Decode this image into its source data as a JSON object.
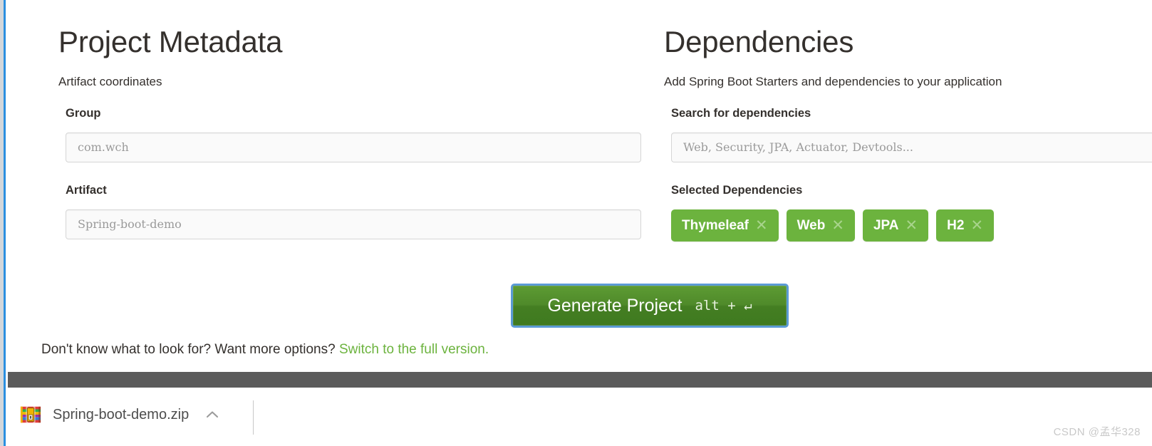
{
  "left_panel": {
    "title": "Project Metadata",
    "subtitle": "Artifact coordinates",
    "group": {
      "label": "Group",
      "value": "com.wch"
    },
    "artifact": {
      "label": "Artifact",
      "value": "Spring-boot-demo"
    }
  },
  "right_panel": {
    "title": "Dependencies",
    "subtitle": "Add Spring Boot Starters and dependencies to your application",
    "search": {
      "label": "Search for dependencies",
      "value": "",
      "placeholder": "Web, Security, JPA, Actuator, Devtools..."
    },
    "selected": {
      "label": "Selected Dependencies",
      "chips": [
        {
          "label": "Thymeleaf",
          "remove_icon": "close-icon"
        },
        {
          "label": "Web",
          "remove_icon": "close-icon"
        },
        {
          "label": "JPA",
          "remove_icon": "close-icon"
        },
        {
          "label": "H2",
          "remove_icon": "close-icon"
        }
      ]
    }
  },
  "actions": {
    "generate_label": "Generate Project",
    "generate_shortcut": "alt + ↵"
  },
  "footer": {
    "note": "Don't know what to look for? Want more options?",
    "link": "Switch to the full version."
  },
  "download_shelf": {
    "filename": "Spring-boot-demo.zip",
    "file_icon": "zip-archive-icon",
    "menu_icon": "chevron-up-icon"
  },
  "watermark": "CSDN @孟华328",
  "colors": {
    "brand_green": "#6cb33e",
    "button_green": "#4f8a2a",
    "focus_blue": "#5b9bd5",
    "shelf_gray": "#5b5b5b",
    "text_dark": "#34302d",
    "input_placeholder": "#9a9a9a"
  }
}
